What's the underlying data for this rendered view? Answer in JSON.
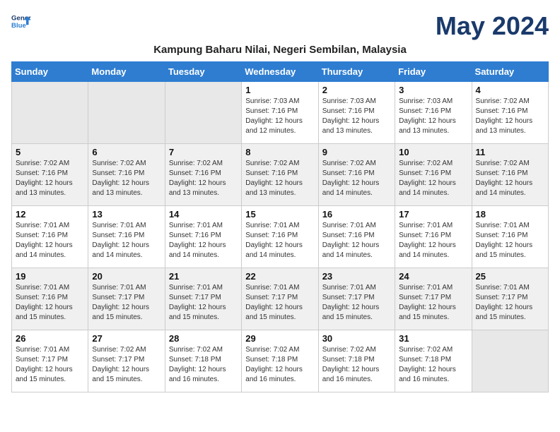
{
  "header": {
    "logo_line1": "General",
    "logo_line2": "Blue",
    "month_title": "May 2024",
    "subtitle": "Kampung Baharu Nilai, Negeri Sembilan, Malaysia"
  },
  "days_of_week": [
    "Sunday",
    "Monday",
    "Tuesday",
    "Wednesday",
    "Thursday",
    "Friday",
    "Saturday"
  ],
  "weeks": [
    [
      {
        "num": "",
        "info": ""
      },
      {
        "num": "",
        "info": ""
      },
      {
        "num": "",
        "info": ""
      },
      {
        "num": "1",
        "info": "Sunrise: 7:03 AM\nSunset: 7:16 PM\nDaylight: 12 hours\nand 12 minutes."
      },
      {
        "num": "2",
        "info": "Sunrise: 7:03 AM\nSunset: 7:16 PM\nDaylight: 12 hours\nand 13 minutes."
      },
      {
        "num": "3",
        "info": "Sunrise: 7:03 AM\nSunset: 7:16 PM\nDaylight: 12 hours\nand 13 minutes."
      },
      {
        "num": "4",
        "info": "Sunrise: 7:02 AM\nSunset: 7:16 PM\nDaylight: 12 hours\nand 13 minutes."
      }
    ],
    [
      {
        "num": "5",
        "info": "Sunrise: 7:02 AM\nSunset: 7:16 PM\nDaylight: 12 hours\nand 13 minutes."
      },
      {
        "num": "6",
        "info": "Sunrise: 7:02 AM\nSunset: 7:16 PM\nDaylight: 12 hours\nand 13 minutes."
      },
      {
        "num": "7",
        "info": "Sunrise: 7:02 AM\nSunset: 7:16 PM\nDaylight: 12 hours\nand 13 minutes."
      },
      {
        "num": "8",
        "info": "Sunrise: 7:02 AM\nSunset: 7:16 PM\nDaylight: 12 hours\nand 13 minutes."
      },
      {
        "num": "9",
        "info": "Sunrise: 7:02 AM\nSunset: 7:16 PM\nDaylight: 12 hours\nand 14 minutes."
      },
      {
        "num": "10",
        "info": "Sunrise: 7:02 AM\nSunset: 7:16 PM\nDaylight: 12 hours\nand 14 minutes."
      },
      {
        "num": "11",
        "info": "Sunrise: 7:02 AM\nSunset: 7:16 PM\nDaylight: 12 hours\nand 14 minutes."
      }
    ],
    [
      {
        "num": "12",
        "info": "Sunrise: 7:01 AM\nSunset: 7:16 PM\nDaylight: 12 hours\nand 14 minutes."
      },
      {
        "num": "13",
        "info": "Sunrise: 7:01 AM\nSunset: 7:16 PM\nDaylight: 12 hours\nand 14 minutes."
      },
      {
        "num": "14",
        "info": "Sunrise: 7:01 AM\nSunset: 7:16 PM\nDaylight: 12 hours\nand 14 minutes."
      },
      {
        "num": "15",
        "info": "Sunrise: 7:01 AM\nSunset: 7:16 PM\nDaylight: 12 hours\nand 14 minutes."
      },
      {
        "num": "16",
        "info": "Sunrise: 7:01 AM\nSunset: 7:16 PM\nDaylight: 12 hours\nand 14 minutes."
      },
      {
        "num": "17",
        "info": "Sunrise: 7:01 AM\nSunset: 7:16 PM\nDaylight: 12 hours\nand 14 minutes."
      },
      {
        "num": "18",
        "info": "Sunrise: 7:01 AM\nSunset: 7:16 PM\nDaylight: 12 hours\nand 15 minutes."
      }
    ],
    [
      {
        "num": "19",
        "info": "Sunrise: 7:01 AM\nSunset: 7:16 PM\nDaylight: 12 hours\nand 15 minutes."
      },
      {
        "num": "20",
        "info": "Sunrise: 7:01 AM\nSunset: 7:17 PM\nDaylight: 12 hours\nand 15 minutes."
      },
      {
        "num": "21",
        "info": "Sunrise: 7:01 AM\nSunset: 7:17 PM\nDaylight: 12 hours\nand 15 minutes."
      },
      {
        "num": "22",
        "info": "Sunrise: 7:01 AM\nSunset: 7:17 PM\nDaylight: 12 hours\nand 15 minutes."
      },
      {
        "num": "23",
        "info": "Sunrise: 7:01 AM\nSunset: 7:17 PM\nDaylight: 12 hours\nand 15 minutes."
      },
      {
        "num": "24",
        "info": "Sunrise: 7:01 AM\nSunset: 7:17 PM\nDaylight: 12 hours\nand 15 minutes."
      },
      {
        "num": "25",
        "info": "Sunrise: 7:01 AM\nSunset: 7:17 PM\nDaylight: 12 hours\nand 15 minutes."
      }
    ],
    [
      {
        "num": "26",
        "info": "Sunrise: 7:01 AM\nSunset: 7:17 PM\nDaylight: 12 hours\nand 15 minutes."
      },
      {
        "num": "27",
        "info": "Sunrise: 7:02 AM\nSunset: 7:17 PM\nDaylight: 12 hours\nand 15 minutes."
      },
      {
        "num": "28",
        "info": "Sunrise: 7:02 AM\nSunset: 7:18 PM\nDaylight: 12 hours\nand 16 minutes."
      },
      {
        "num": "29",
        "info": "Sunrise: 7:02 AM\nSunset: 7:18 PM\nDaylight: 12 hours\nand 16 minutes."
      },
      {
        "num": "30",
        "info": "Sunrise: 7:02 AM\nSunset: 7:18 PM\nDaylight: 12 hours\nand 16 minutes."
      },
      {
        "num": "31",
        "info": "Sunrise: 7:02 AM\nSunset: 7:18 PM\nDaylight: 12 hours\nand 16 minutes."
      },
      {
        "num": "",
        "info": ""
      }
    ]
  ]
}
